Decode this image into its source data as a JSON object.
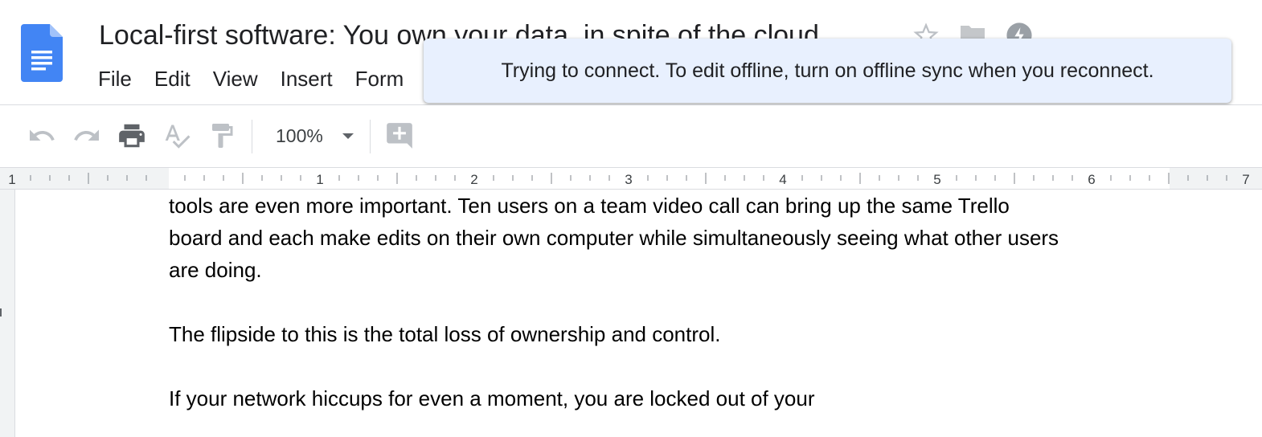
{
  "document": {
    "title": "Local-first software: You own your data, in spite of the cloud"
  },
  "menu": {
    "items": [
      "File",
      "Edit",
      "View",
      "Insert",
      "Form"
    ]
  },
  "toast": {
    "message": "Trying to connect. To edit offline, turn on offline sync when you reconnect."
  },
  "toolbar": {
    "zoom_value": "100%",
    "icons": [
      "undo-icon",
      "redo-icon",
      "print-icon",
      "spellcheck-icon",
      "paint-format-icon",
      "add-comment-icon"
    ]
  },
  "ruler": {
    "left_label": "1",
    "labels": [
      "1",
      "2",
      "3",
      "4",
      "5",
      "6",
      "7"
    ]
  },
  "body": {
    "lines": [
      "tools are even more important. Ten users on a team video call can bring up the same Trello",
      "board and each make edits on their own computer while simultaneously seeing what other users",
      "are doing.",
      "",
      "The flipside to this is the total loss of ownership and control.",
      "",
      "If your network hiccups for even a moment, you are locked out of your"
    ]
  },
  "colors": {
    "doc_blue": "#4285f4",
    "toast_bg": "#e8f0fe",
    "icon_gray": "#5f6368",
    "disabled_gray": "#bdc1c6"
  }
}
